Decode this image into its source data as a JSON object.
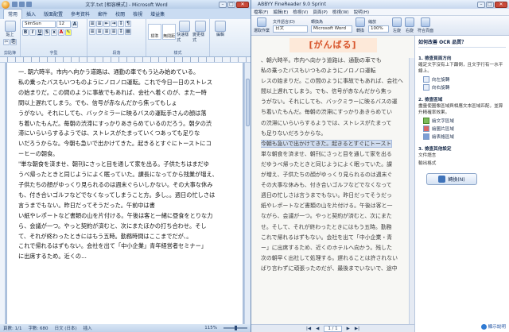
{
  "word": {
    "title": "文字.txt [相容模式] - Microsoft Word",
    "tabs": [
      "常用",
      "插入",
      "版面配置",
      "參考資料",
      "郵件",
      "校閱",
      "檢視",
      "增益集"
    ],
    "ribbon": {
      "paste_label": "貼上",
      "font_name": "SimSun",
      "font_size": "12",
      "style_normal": "標準",
      "style_nospacing": "無間距",
      "change_styles": "樣式",
      "quick_styles": "快速樣式",
      "change_style_label": "變更樣式",
      "edit_label": "編輯",
      "groups": [
        "剪貼簿",
        "字型",
        "段落",
        "樣式"
      ]
    },
    "document_lines": [
      "一. 朝六時半。市内へ向かう道路は、通勤の車でもう込み始めている。",
      "私の乗ったバスもいつものようにノロノロ運転。これで今日一日のストレス",
      "の始まりだ。この間のように事故でもあれば、会社へ着くのが、また一時",
      "間以上遅れてしまう。でも、信号が赤なんだから焦ってもしょ",
      "うがない。それにしても、バックミラーに映るバスの運転手さんの顔は落",
      "ち着いたもんだ。毎朝の渋滞にすっかりあきらめているのだろう。朝夕の渋",
      "滞にいらいらするようでは、ストレスがたまっていくつあっても足りな",
      "いだろうからな。今朝も急いで出かけてきた。起きるとすぐにトーストにコ",
      "ーヒーの朝食。",
      "\"単な朝食を済ませ、朝刊にさっと目を通して家を出る。子供たちはまだゆ",
      "うべ帰ったときと同じようによく眠っていた。課長になってから残業が増え、",
      "子供たちの顔がゆっくり見られるのは週末ぐらいしかない。その大事な休み",
      "も、付き合いゴルフなどでなくなってしまうこと方。多し。。週日の忙しさは",
      "言うまでもない。昨日だってそうだった。午前中は書",
      "い紙やレポートなど書類の山を片付ける。午後は客と一緒に昼食をとりな力",
      "ら、会議が一つ。やっと契約が済むと、次にまたほかの打ち合わせ。そし",
      "て、それが終わったときにはもう五時。勤務時間はここまでだが、。",
      "これで帰れるはずもない。会社を出て「中小企業」青年経営者セミナー」",
      "に出席するため。近くの..."
    ],
    "status": {
      "page": "頁數: 1/1",
      "words": "字數: 680",
      "language": "日文 (日本)",
      "mode": "插入",
      "zoom": "115%"
    }
  },
  "finereader": {
    "title": "ABBYY FineReader 9.0 Sprint",
    "menu": [
      "檔案(F)",
      "編輯(E)",
      "檢視(V)",
      "頁面(P)",
      "檢視(W)",
      "說明(H)"
    ],
    "toolbar": {
      "auto_recognize_label": "選取作業",
      "doc_language_label": "文件語言(D)",
      "doc_language_value": "日文",
      "convert_to_label": "轉換為",
      "convert_to_value": "Microsoft Word",
      "convert_btn": "轉換",
      "zoom_label": "縮放",
      "zoom_value": "100%",
      "rotate_left": "左旋",
      "rotate_right": "右旋",
      "fit_page": "符合頁面"
    },
    "doc_heading": "[がんばる]",
    "scan_lines": [
      "、朝六時半。市内へ向かう道路は、通勤の車でも",
      "私の乗ったバスもいつものようにノロノロ運転",
      "レスの始まりだ。この間のように事故でもあれば、会社へ",
      "間以上遅れてしまう。でも、信号が赤なんだから焦っ",
      "うがない。それにしても、バックミラーに映るバスの運",
      "ち着いたもんだ。毎朝の渋滞にすっかりあきらめてい",
      "の渋滞にいらいらするようでは、ストレスがたまって",
      "も足りないだろうからな。",
      "今朝も急いで出かけてきた。起きるとすぐにトースト",
      "単な朝食を済ませ、朝刊にさっと目を通して家を出る",
      "だゆうべ帰ったときと同じようによく眠っていた。課",
      "が増え、子供たちの顔がゆっくり見られるのは週末ぐ",
      "その大事な休みも、付き合いゴルフなどでなくなって",
      "週日の忙しさは言うまでもない。昨日だってそうだっ",
      "紙やレポートなど書類の山を片付ける。午後は客と一",
      "ながら、会議が一つ。やっと契約が済むと、次にまた",
      "せ。そして、それが終わったときにはもう五時。勤務",
      "これで帰れるはずもない。会社を出て「中小企業・青",
      "ー」に出席するため、近くのホテルへ向かう。残した",
      "次の朝早く出社して処理する。遅れることは許されない",
      "ばり言わずに頑張ったのだが、最後までいないで、途中"
    ],
    "nav": {
      "page": "1 / 1"
    },
    "task": {
      "heading": "如何改善 OCR 品質？",
      "sec1": "1. 檢查頁面方向",
      "sec1_desc": "確定文字沒有上下顛倒，且文字行有一水平線上。",
      "sec1_btns": [
        "向左旋轉",
        "向右旋轉"
      ],
      "sec2": "2. 檢查區域",
      "sec2_desc": "盡量使圖像區域與相應文本區域匹配，並算升精確率效果。",
      "sec2_btns": [
        "繪文字區域",
        "繪圖片區域",
        "繪表格區域"
      ],
      "sec3": "3. 檢查其他設定",
      "sec3_items": [
        "文件語言",
        "輸出格式"
      ],
      "convert_btn": "轉換(N)",
      "help": "顯示說明"
    }
  }
}
